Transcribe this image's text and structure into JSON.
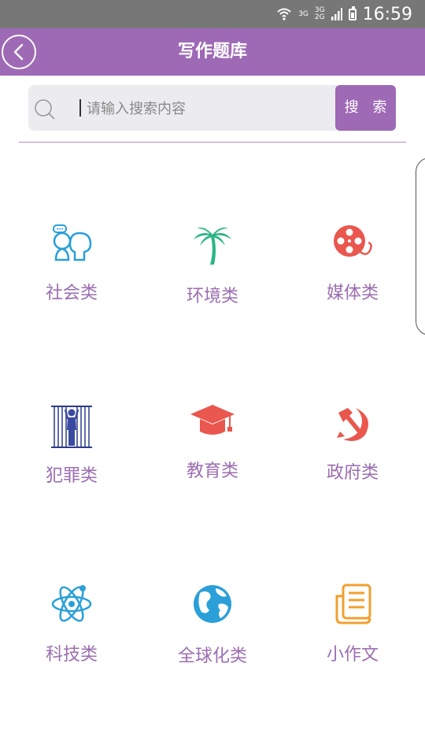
{
  "status_bar": {
    "net_a": "3G",
    "net_b_top": "3G",
    "net_b_bottom": "2G",
    "time": "16:59"
  },
  "header": {
    "title": "写作题库",
    "back_icon": "chevron-left-icon"
  },
  "search": {
    "placeholder": "请输入搜索内容",
    "value": "",
    "button_label": "搜 索"
  },
  "categories": [
    {
      "label": "社会类",
      "icon": "people-chat-icon",
      "color": "#2a9fd8"
    },
    {
      "label": "环境类",
      "icon": "palm-tree-icon",
      "color": "#2bb585"
    },
    {
      "label": "媒体类",
      "icon": "film-reel-icon",
      "color": "#e9574e"
    },
    {
      "label": "犯罪类",
      "icon": "prison-bars-icon",
      "color": "#2d3b8c"
    },
    {
      "label": "教育类",
      "icon": "graduation-cap-icon",
      "color": "#e9574e"
    },
    {
      "label": "政府类",
      "icon": "hammer-sickle-icon",
      "color": "#e9574e"
    },
    {
      "label": "科技类",
      "icon": "atom-icon",
      "color": "#2a9fd8"
    },
    {
      "label": "全球化类",
      "icon": "globe-icon",
      "color": "#2a9fd8"
    },
    {
      "label": "小作文",
      "icon": "document-icon",
      "color": "#f0a030"
    }
  ],
  "colors": {
    "primary": "#9e69b5",
    "label": "#9b6db0",
    "status_bar": "#777777"
  }
}
